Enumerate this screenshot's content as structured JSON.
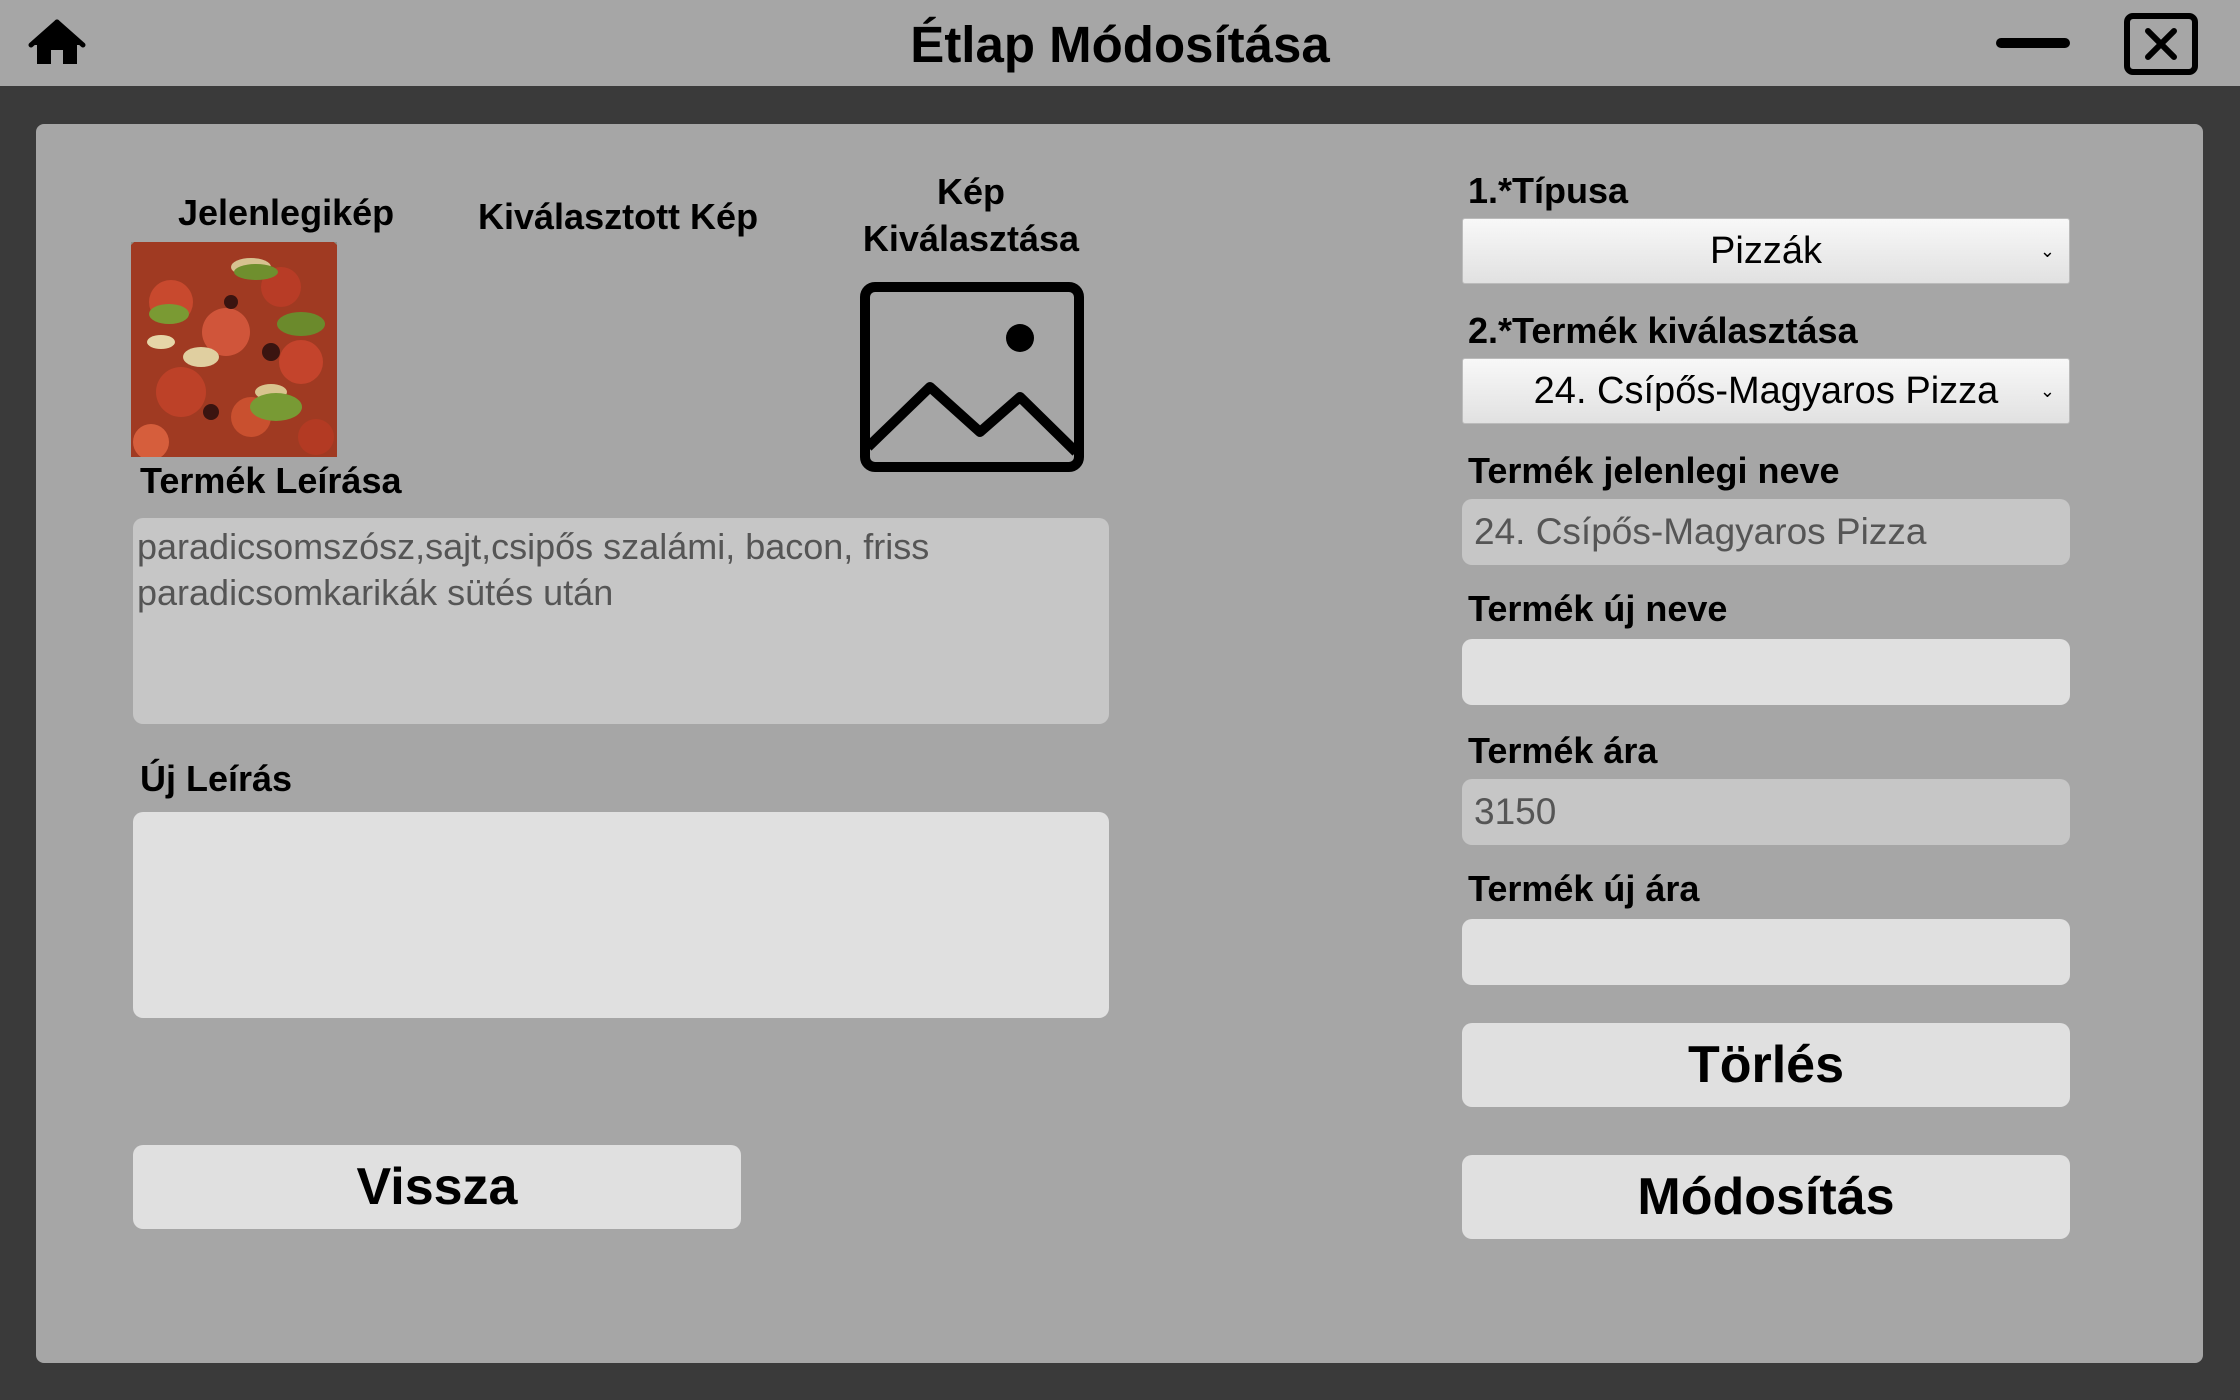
{
  "window": {
    "title": "Étlap Módosítása"
  },
  "images": {
    "current_label": "Jelenlegikép",
    "selected_label": "Kiválasztott Kép",
    "choose_label_line1": "Kép",
    "choose_label_line2": "Kiválasztása"
  },
  "description": {
    "label": "Termék Leírása",
    "value": "paradicsomszósz,sajt,csipős szalámi, bacon, friss paradicsomkarikák sütés után",
    "new_label": "Új Leírás",
    "new_value": ""
  },
  "form": {
    "type_label": "1.*Típusa",
    "type_value": "Pizzák",
    "product_label": "2.*Termék kiválasztása",
    "product_value": "24. Csípős-Magyaros Pizza",
    "current_name_label": "Termék jelenlegi neve",
    "current_name_value": "24. Csípős-Magyaros Pizza",
    "new_name_label": "Termék új neve",
    "new_name_value": "",
    "price_label": "Termék ára",
    "price_value": "3150",
    "new_price_label": "Termék új ára",
    "new_price_value": ""
  },
  "buttons": {
    "back": "Vissza",
    "delete": "Törlés",
    "modify": "Módosítás"
  },
  "icons": {
    "home": "home-icon",
    "minimize": "minimize-icon",
    "close": "close-icon",
    "image_picker": "image-icon",
    "dropdown": "chevron-down-icon"
  }
}
